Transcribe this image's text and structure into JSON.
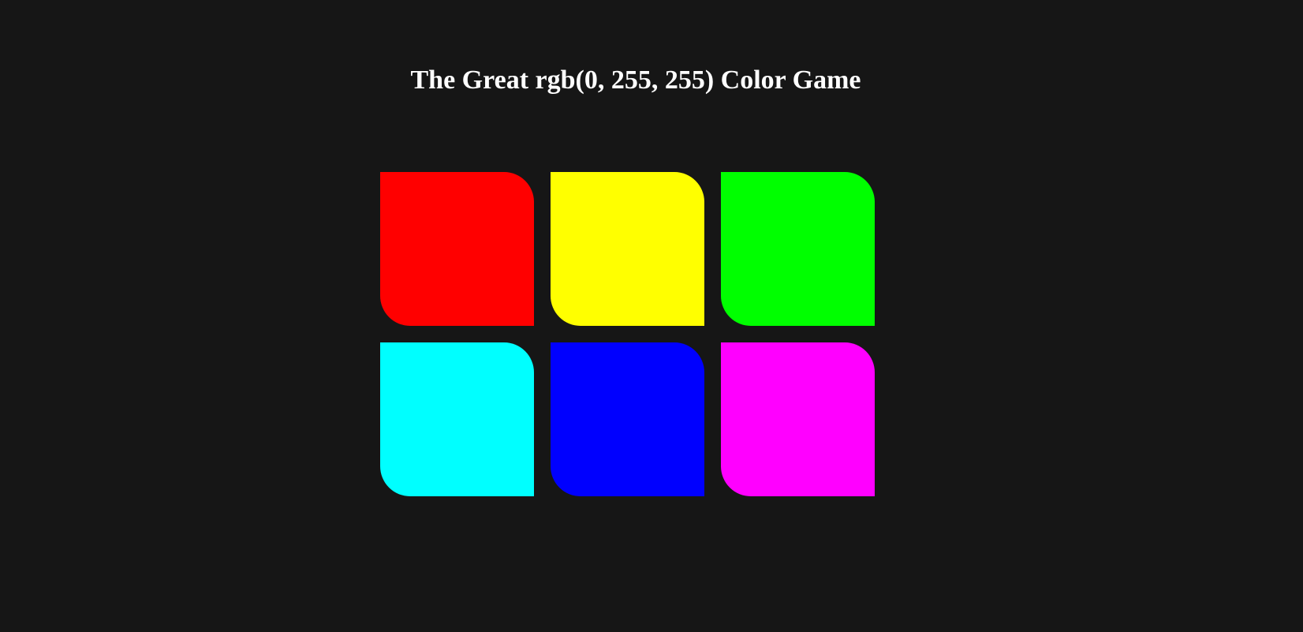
{
  "game": {
    "title": "The Great rgb(0, 255, 255) Color Game",
    "squares": [
      {
        "name": "square-red",
        "color": "#ff0000"
      },
      {
        "name": "square-yellow",
        "color": "#ffff00"
      },
      {
        "name": "square-green",
        "color": "#00ff00"
      },
      {
        "name": "square-cyan",
        "color": "#00ffff"
      },
      {
        "name": "square-blue",
        "color": "#0000ff"
      },
      {
        "name": "square-magenta",
        "color": "#ff00ff"
      }
    ]
  },
  "colors": {
    "background": "#161616",
    "title_text": "#ffffff"
  }
}
